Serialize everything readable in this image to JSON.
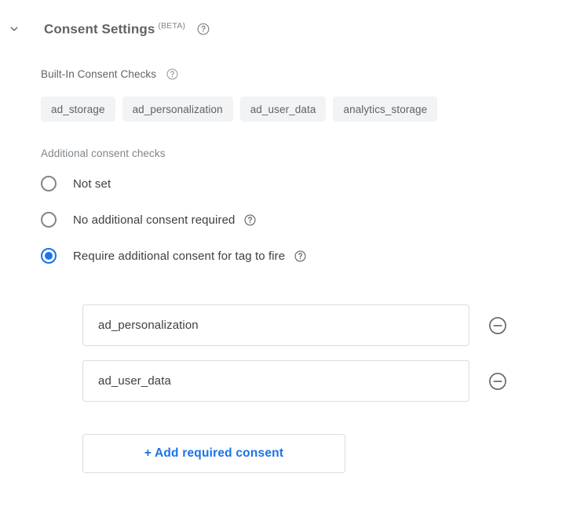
{
  "section": {
    "title": "Consent Settings",
    "beta_tag": "(BETA)",
    "collapse_icon": "chevron-down-icon",
    "help_icon": "help-circle-icon"
  },
  "builtin_consent": {
    "label": "Built-In Consent Checks",
    "help_icon": "help-circle-icon",
    "chips": [
      "ad_storage",
      "ad_personalization",
      "ad_user_data",
      "analytics_storage"
    ]
  },
  "additional_consent": {
    "label": "Additional consent checks",
    "selected_index": 2,
    "options": [
      {
        "label": "Not set",
        "has_help": false,
        "selected": false
      },
      {
        "label": "No additional consent required",
        "has_help": true,
        "selected": false
      },
      {
        "label": "Require additional consent for tag to fire",
        "has_help": true,
        "selected": true
      }
    ]
  },
  "required_consents": {
    "rows": [
      {
        "value": "ad_personalization",
        "placeholder": "",
        "remove_icon": "minus-circle-icon"
      },
      {
        "value": "ad_user_data",
        "placeholder": "",
        "remove_icon": "minus-circle-icon"
      }
    ],
    "add_button_label": "+ Add required consent"
  },
  "colors": {
    "accent_blue": "#1a73e8",
    "chip_background": "#f1f3f4",
    "label_gray": "#5f6368",
    "muted_gray": "#80868b",
    "border_gray": "#dadce0",
    "text_primary": "#3c4043"
  }
}
